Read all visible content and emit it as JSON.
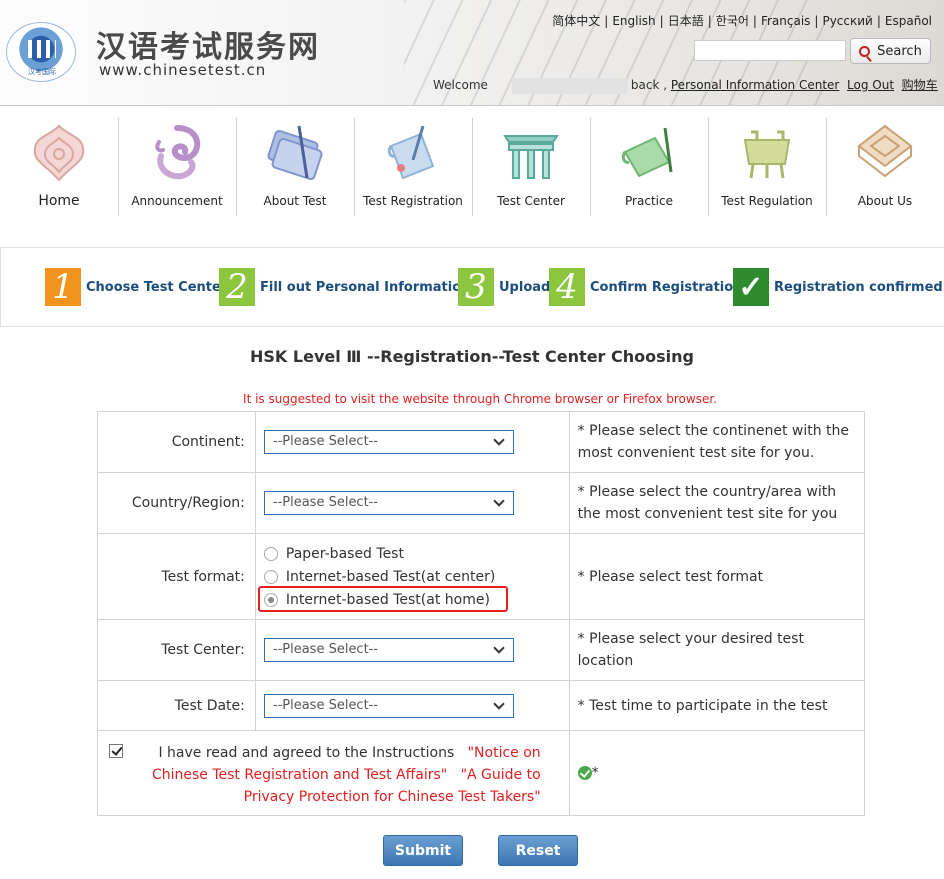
{
  "header": {
    "logo_text": "汉考国际",
    "site_title": "汉语考试服务网",
    "site_url": "www.chinesetest.cn",
    "languages": [
      "简体中文",
      "English",
      "日本語",
      "한국어",
      "Français",
      "Русский",
      "Español"
    ],
    "search_label": "Search",
    "welcome": "Welcome",
    "back": "back ,",
    "personal_center": "Personal Information Center",
    "logout": "Log Out",
    "cart": "购物车"
  },
  "nav": {
    "items": [
      {
        "label": "Home",
        "icon": "home-icon"
      },
      {
        "label": "Announcement",
        "icon": "announcement-icon"
      },
      {
        "label": "About Test",
        "icon": "about-test-icon"
      },
      {
        "label": "Test Registration",
        "icon": "test-registration-icon"
      },
      {
        "label": "Test Center",
        "icon": "test-center-icon"
      },
      {
        "label": "Practice",
        "icon": "practice-icon"
      },
      {
        "label": "Test Regulation",
        "icon": "test-regulation-icon"
      },
      {
        "label": "About Us",
        "icon": "about-us-icon"
      }
    ]
  },
  "steps": [
    {
      "num": "1",
      "label": "Choose Test Center",
      "color": "#f0941e"
    },
    {
      "num": "2",
      "label": "Fill out Personal Information",
      "color": "#8cc63f"
    },
    {
      "num": "3",
      "label": "Upload",
      "color": "#8cc63f"
    },
    {
      "num": "4",
      "label": "Confirm Registration",
      "color": "#8cc63f"
    },
    {
      "num": "✓",
      "label": "Registration confirmed",
      "color": "#2e8b2e"
    }
  ],
  "form": {
    "title": "HSK Level Ⅲ --Registration--Test Center Choosing",
    "notice": "It is suggested to visit the website through Chrome browser or Firefox browser.",
    "continent": {
      "label": "Continent:",
      "value": "--Please Select--",
      "hint": "* Please select the continenet with the most convenient test site for you."
    },
    "country": {
      "label": "Country/Region:",
      "value": "--Please Select--",
      "hint": "* Please select the country/area with the most convenient test site for you"
    },
    "format": {
      "label": "Test format:",
      "options": [
        "Paper-based Test",
        "Internet-based Test(at center)",
        "Internet-based Test(at home)"
      ],
      "selected": 2,
      "hint": "* Please select test format"
    },
    "center": {
      "label": "Test Center:",
      "value": "--Please Select--",
      "hint": "* Please select your desired test location"
    },
    "date": {
      "label": "Test Date:",
      "value": "--Please Select--",
      "hint": "* Test time to participate in the test"
    },
    "agree": {
      "text": "I have read and agreed to the Instructions",
      "link1": "\"Notice on Chinese Test Registration and Test Affairs\"",
      "link2": "\"A Guide to Privacy Protection for Chinese Test Takers\"",
      "status_mark": "*"
    },
    "submit": "Submit",
    "reset": "Reset"
  }
}
